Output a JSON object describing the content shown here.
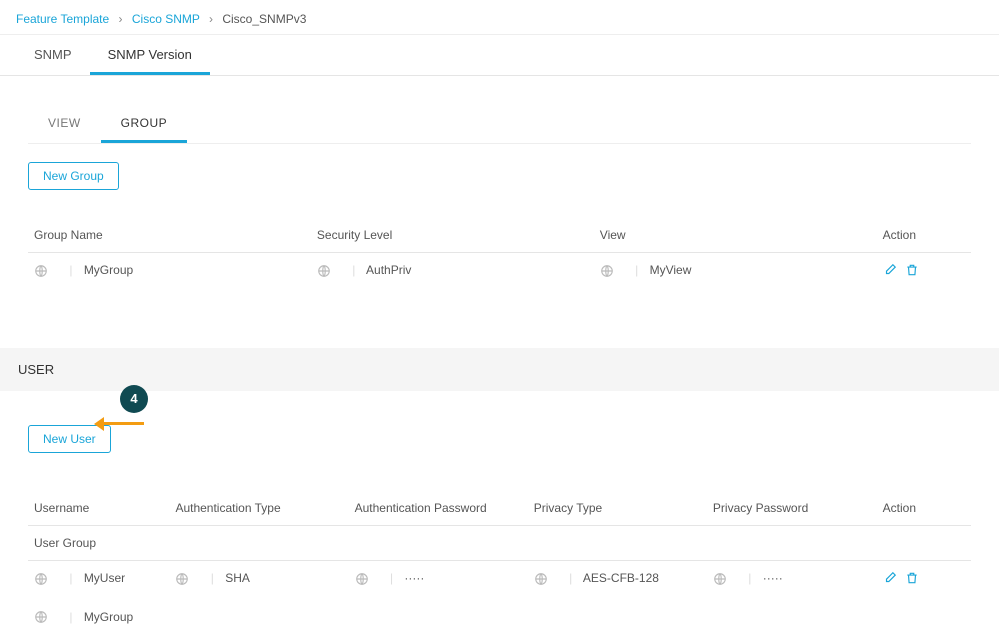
{
  "breadcrumb": {
    "item1": "Feature Template",
    "item2": "Cisco SNMP",
    "current": "Cisco_SNMPv3"
  },
  "primaryTabs": {
    "snmp": "SNMP",
    "snmpVersion": "SNMP Version"
  },
  "subTabs": {
    "view": "VIEW",
    "group": "GROUP"
  },
  "buttons": {
    "newGroup": "New Group",
    "newUser": "New User"
  },
  "stepBadge": "4",
  "groupTable": {
    "headers": {
      "groupName": "Group Name",
      "securityLevel": "Security Level",
      "view": "View",
      "action": "Action"
    },
    "row": {
      "groupName": "MyGroup",
      "securityLevel": "AuthPriv",
      "view": "MyView"
    }
  },
  "userSection": {
    "title": "USER"
  },
  "userTable": {
    "headers": {
      "username": "Username",
      "authType": "Authentication Type",
      "authPassword": "Authentication Password",
      "privacyType": "Privacy Type",
      "privacyPassword": "Privacy Password",
      "action": "Action",
      "userGroup": "User Group"
    },
    "row": {
      "username": "MyUser",
      "authType": "SHA",
      "authPassword": "·····",
      "privacyType": "AES-CFB-128",
      "privacyPassword": "·····",
      "userGroup": "MyGroup"
    }
  }
}
